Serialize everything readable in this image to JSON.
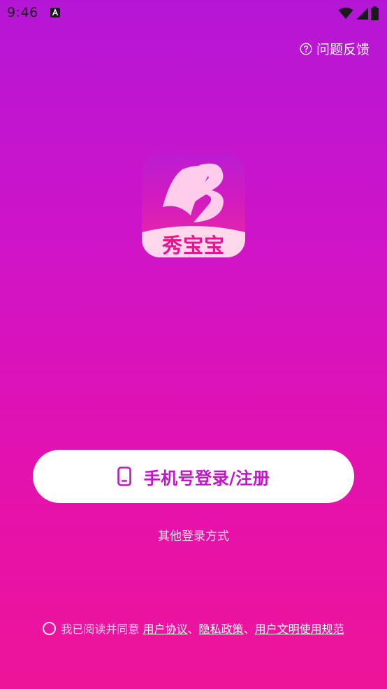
{
  "status_bar": {
    "time": "9:46",
    "notification_icon": "a-icon",
    "icons": [
      "wifi-icon",
      "signal-icon",
      "battery-icon"
    ],
    "text_color": "#1a1a1a"
  },
  "feedback": {
    "icon": "question-circle-icon",
    "label": "问题反馈"
  },
  "logo": {
    "text": "秀宝宝",
    "text_color": "#e6148f",
    "bottom_color": "#ffd8ec"
  },
  "login_button": {
    "icon": "phone-icon",
    "label": "手机号登录/注册",
    "label_color": "#c016c6"
  },
  "other_login": {
    "label": "其他登录方式"
  },
  "agreement": {
    "prefix": "我已阅读并同意",
    "separator": "、",
    "links": [
      "用户协议",
      "隐私政策",
      "用户文明使用规范"
    ]
  },
  "colors": {
    "gradient_top": "#b516d6",
    "gradient_bottom": "#ee1499",
    "button_bg": "#ffffff"
  }
}
